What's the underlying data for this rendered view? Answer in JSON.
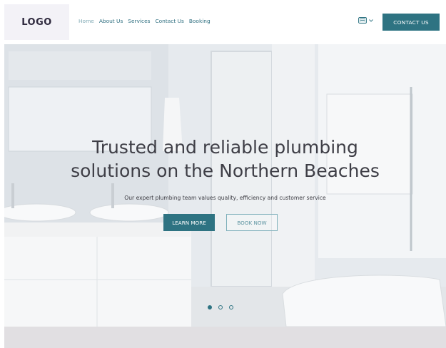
{
  "header": {
    "logo": "LOGO",
    "nav": [
      "Home",
      "About Us",
      "Services",
      "Contact Us",
      "Booking"
    ],
    "contact_label": "CONTACT US",
    "language_icon": "flag-icon"
  },
  "hero": {
    "title_line1": "Trusted and reliable plumbing",
    "title_line2": "solutions on the Northern Beaches",
    "subtitle": "Our expert plumbing team values quality, efficiency and customer service",
    "learn_more": "LEARN MORE",
    "book_now": "BOOK NOW",
    "slides": 3,
    "active_slide": 1
  },
  "colors": {
    "accent": "#2e7382",
    "link": "#2f6f80"
  }
}
